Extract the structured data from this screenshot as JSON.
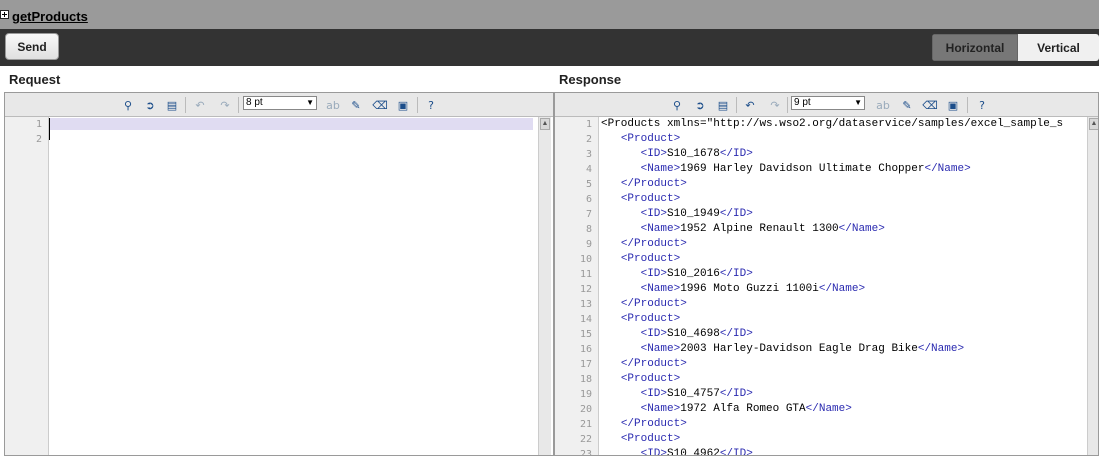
{
  "header": {
    "operation_title": "getProducts"
  },
  "actions": {
    "send_label": "Send",
    "layout_horizontal": "Horizontal",
    "layout_vertical": "Vertical"
  },
  "request": {
    "label": "Request",
    "font_size": "8 pt",
    "line_numbers": [
      "1",
      "2"
    ]
  },
  "response": {
    "label": "Response",
    "font_size": "9 pt",
    "line_numbers": [
      "1",
      "2",
      "3",
      "4",
      "5",
      "6",
      "7",
      "8",
      "9",
      "10",
      "11",
      "12",
      "13",
      "14",
      "15",
      "16",
      "17",
      "18",
      "19",
      "20",
      "21",
      "22",
      "23"
    ],
    "lines": [
      {
        "indent": "",
        "open": "<Products",
        "text": " xmlns=\"http://ws.wso2.org/dataservice/samples/excel_sample_s",
        "close": ""
      },
      {
        "indent": "   ",
        "open": "<Product>",
        "text": "",
        "close": ""
      },
      {
        "indent": "      ",
        "open": "<ID>",
        "text": "S10_1678",
        "close": "</ID>"
      },
      {
        "indent": "      ",
        "open": "<Name>",
        "text": "1969 Harley Davidson Ultimate Chopper",
        "close": "</Name>"
      },
      {
        "indent": "   ",
        "open": "</Product>",
        "text": "",
        "close": ""
      },
      {
        "indent": "   ",
        "open": "<Product>",
        "text": "",
        "close": ""
      },
      {
        "indent": "      ",
        "open": "<ID>",
        "text": "S10_1949",
        "close": "</ID>"
      },
      {
        "indent": "      ",
        "open": "<Name>",
        "text": "1952 Alpine Renault 1300",
        "close": "</Name>"
      },
      {
        "indent": "   ",
        "open": "</Product>",
        "text": "",
        "close": ""
      },
      {
        "indent": "   ",
        "open": "<Product>",
        "text": "",
        "close": ""
      },
      {
        "indent": "      ",
        "open": "<ID>",
        "text": "S10_2016",
        "close": "</ID>"
      },
      {
        "indent": "      ",
        "open": "<Name>",
        "text": "1996 Moto Guzzi 1100i",
        "close": "</Name>"
      },
      {
        "indent": "   ",
        "open": "</Product>",
        "text": "",
        "close": ""
      },
      {
        "indent": "   ",
        "open": "<Product>",
        "text": "",
        "close": ""
      },
      {
        "indent": "      ",
        "open": "<ID>",
        "text": "S10_4698",
        "close": "</ID>"
      },
      {
        "indent": "      ",
        "open": "<Name>",
        "text": "2003 Harley-Davidson Eagle Drag Bike",
        "close": "</Name>"
      },
      {
        "indent": "   ",
        "open": "</Product>",
        "text": "",
        "close": ""
      },
      {
        "indent": "   ",
        "open": "<Product>",
        "text": "",
        "close": ""
      },
      {
        "indent": "      ",
        "open": "<ID>",
        "text": "S10_4757",
        "close": "</ID>"
      },
      {
        "indent": "      ",
        "open": "<Name>",
        "text": "1972 Alfa Romeo GTA",
        "close": "</Name>"
      },
      {
        "indent": "   ",
        "open": "</Product>",
        "text": "",
        "close": ""
      },
      {
        "indent": "   ",
        "open": "<Product>",
        "text": "",
        "close": ""
      },
      {
        "indent": "      ",
        "open": "<ID>",
        "text": "S10_4962",
        "close": "</ID>"
      }
    ]
  },
  "toolbar_icons": [
    "find-icon",
    "goto-line-icon",
    "select-all-icon",
    "undo-icon",
    "redo-icon",
    "spellcheck-icon",
    "reindent-icon",
    "eraser-icon",
    "toggle-editor-icon",
    "help-icon"
  ]
}
